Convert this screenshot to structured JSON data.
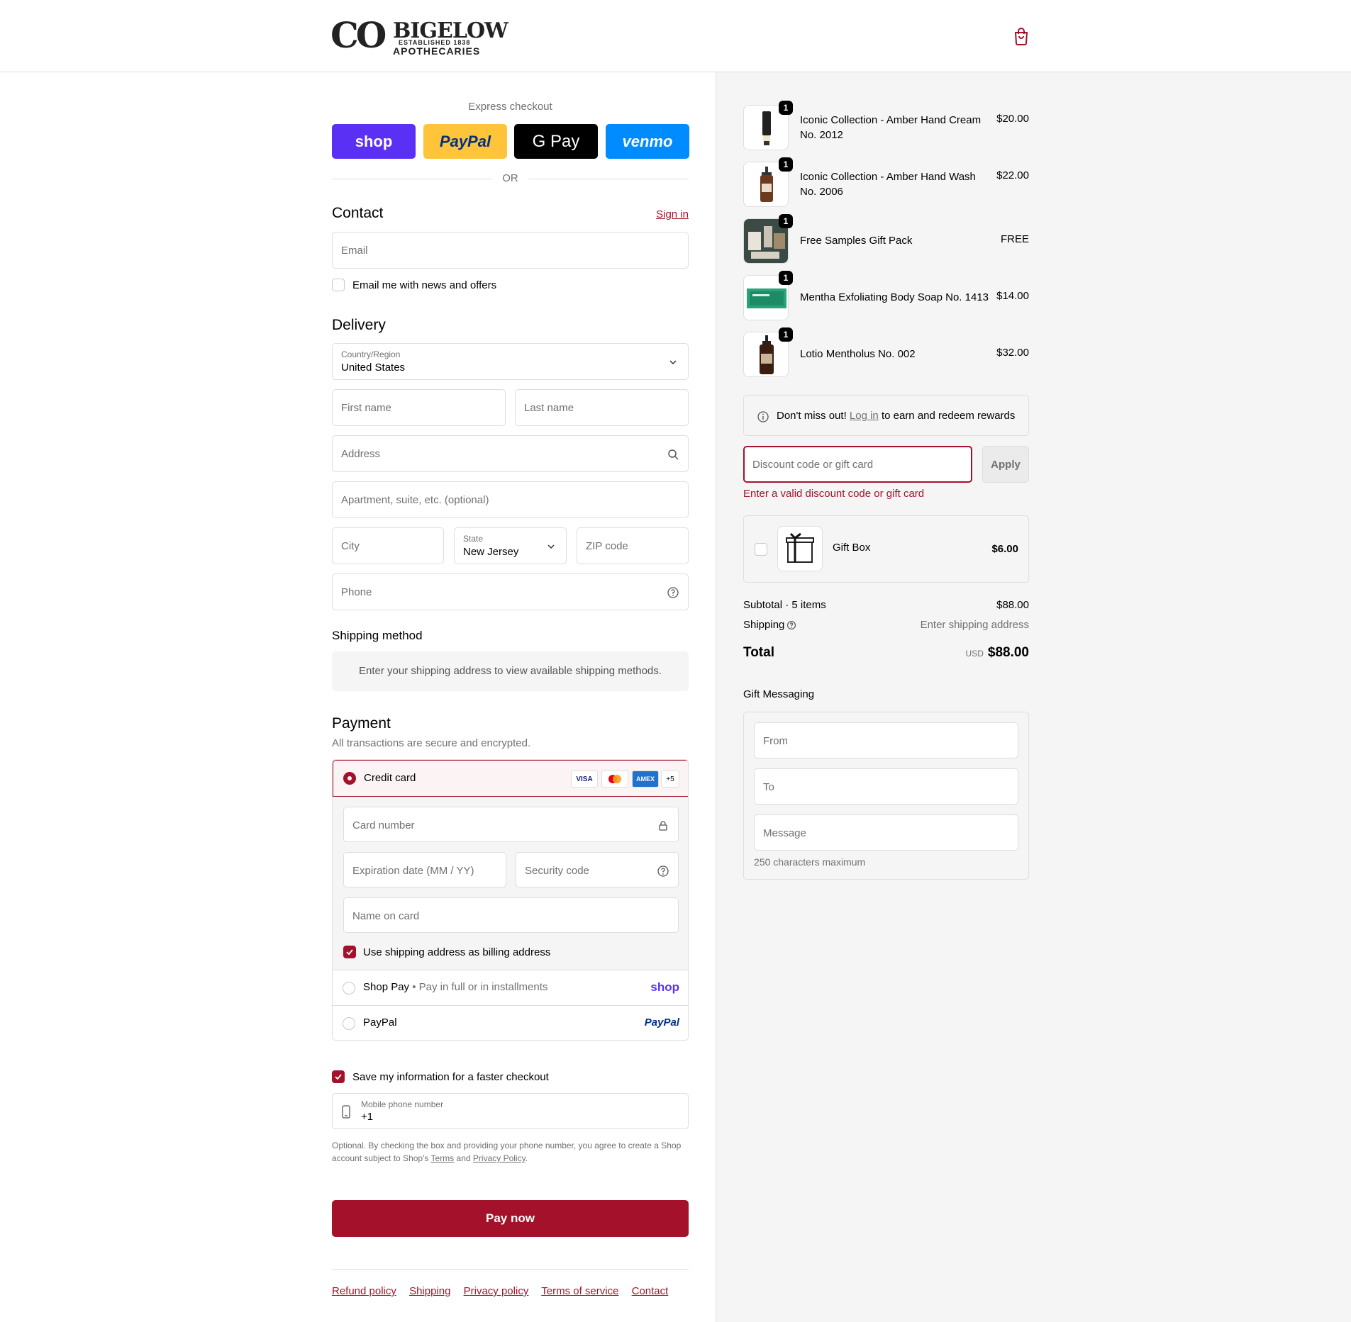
{
  "brand": {
    "logo_big": "CO",
    "logo_word": "BIGELOW",
    "logo_established": "ESTABLISHED 1838",
    "logo_sub": "APOTHECARIES",
    "accent_color": "#a3122a"
  },
  "header": {
    "cart_icon": "shopping-bag-icon"
  },
  "express": {
    "title": "Express checkout",
    "shop_label": "shop",
    "paypal_label": "PayPal",
    "gpay_label": "G Pay",
    "venmo_label": "venmo",
    "or_label": "OR"
  },
  "contact": {
    "title": "Contact",
    "sign_in": "Sign in",
    "email_placeholder": "Email",
    "news_label": "Email me with news and offers"
  },
  "delivery": {
    "title": "Delivery",
    "country_label": "Country/Region",
    "country_value": "United States",
    "first_name": "First name",
    "last_name": "Last name",
    "address": "Address",
    "apartment": "Apartment, suite, etc. (optional)",
    "city": "City",
    "state_label": "State",
    "state_value": "New Jersey",
    "zip": "ZIP code",
    "phone": "Phone"
  },
  "shipping_method": {
    "title": "Shipping method",
    "message": "Enter your shipping address to view available shipping methods."
  },
  "payment": {
    "title": "Payment",
    "subtitle": "All transactions are secure and encrypted.",
    "credit_card_label": "Credit card",
    "card_badges": [
      "VISA",
      "MC",
      "AMEX",
      "+5"
    ],
    "card_number": "Card number",
    "expiration": "Expiration date (MM / YY)",
    "security_code": "Security code",
    "name_on_card": "Name on card",
    "billing_same": "Use shipping address as billing address",
    "shop_pay_label": "Shop Pay",
    "shop_pay_sep": "•",
    "shop_pay_desc": "Pay in full or in installments",
    "shop_pay_logo": "shop",
    "paypal_label": "PayPal",
    "paypal_logo": "PayPal"
  },
  "save_info": {
    "label": "Save my information for a faster checkout",
    "mobile_label": "Mobile phone number",
    "mobile_value": "+1",
    "legal_1": "Optional. By checking the box and providing your phone number, you agree to create a Shop",
    "legal_2": "account subject to Shop's",
    "terms": "Terms",
    "and": "and",
    "privacy": "Privacy Policy",
    "period": "."
  },
  "pay_now": "Pay now",
  "footer_links": [
    "Refund policy",
    "Shipping",
    "Privacy policy",
    "Terms of service",
    "Contact"
  ],
  "cart": {
    "items": [
      {
        "name": "Iconic Collection - Amber Hand Cream No. 2012",
        "price": "$20.00",
        "qty": "1"
      },
      {
        "name": "Iconic Collection - Amber Hand Wash No. 2006",
        "price": "$22.00",
        "qty": "1"
      },
      {
        "name": "Free Samples Gift Pack",
        "price": "FREE",
        "qty": "1"
      },
      {
        "name": "Mentha Exfoliating Body Soap No. 1413",
        "price": "$14.00",
        "qty": "1"
      },
      {
        "name": "Lotio Mentholus No. 002",
        "price": "$32.00",
        "qty": "1"
      }
    ]
  },
  "rewards": {
    "prefix": "Don't miss out!",
    "link": "Log in",
    "suffix": "to earn and redeem rewards"
  },
  "discount": {
    "placeholder": "Discount code or gift card",
    "apply": "Apply",
    "error": "Enter a valid discount code or gift card"
  },
  "gift_box": {
    "name": "Gift Box",
    "price": "$6.00"
  },
  "totals": {
    "subtotal_label": "Subtotal · 5 items",
    "subtotal_value": "$88.00",
    "shipping_label": "Shipping",
    "shipping_value": "Enter shipping address",
    "total_label": "Total",
    "currency": "USD",
    "total_value": "$88.00"
  },
  "gift_messaging": {
    "title": "Gift Messaging",
    "from": "From",
    "to": "To",
    "message": "Message",
    "hint": "250 characters maximum"
  }
}
